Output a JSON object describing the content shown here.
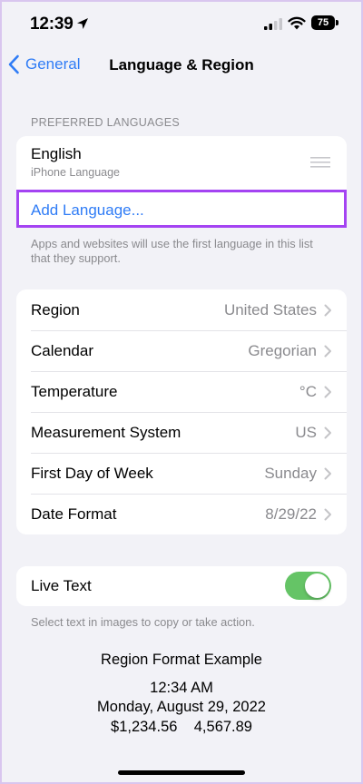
{
  "status_bar": {
    "time": "12:39",
    "battery": "75"
  },
  "nav": {
    "back_label": "General",
    "title": "Language & Region"
  },
  "preferred_languages": {
    "header": "PREFERRED LANGUAGES",
    "language": {
      "name": "English",
      "subtitle": "iPhone Language"
    },
    "add_label": "Add Language...",
    "footnote": "Apps and websites will use the first language in this list that they support."
  },
  "settings": {
    "rows": [
      {
        "label": "Region",
        "value": "United States"
      },
      {
        "label": "Calendar",
        "value": "Gregorian"
      },
      {
        "label": "Temperature",
        "value": "°C"
      },
      {
        "label": "Measurement System",
        "value": "US"
      },
      {
        "label": "First Day of Week",
        "value": "Sunday"
      },
      {
        "label": "Date Format",
        "value": "8/29/22"
      }
    ]
  },
  "live_text": {
    "label": "Live Text",
    "enabled": true,
    "footnote": "Select text in images to copy or take action."
  },
  "region_example": {
    "title": "Region Format Example",
    "time": "12:34 AM",
    "date": "Monday, August 29, 2022",
    "numbers": "$1,234.56    4,567.89"
  },
  "colors": {
    "accent": "#2f7cf6",
    "toggle_on": "#65c466",
    "highlight": "#a443f2"
  },
  "icons": [
    "location-arrow-icon",
    "cellular-signal-icon",
    "wifi-icon",
    "battery-icon",
    "chevron-left-icon",
    "drag-handle-icon",
    "chevron-right-icon"
  ]
}
